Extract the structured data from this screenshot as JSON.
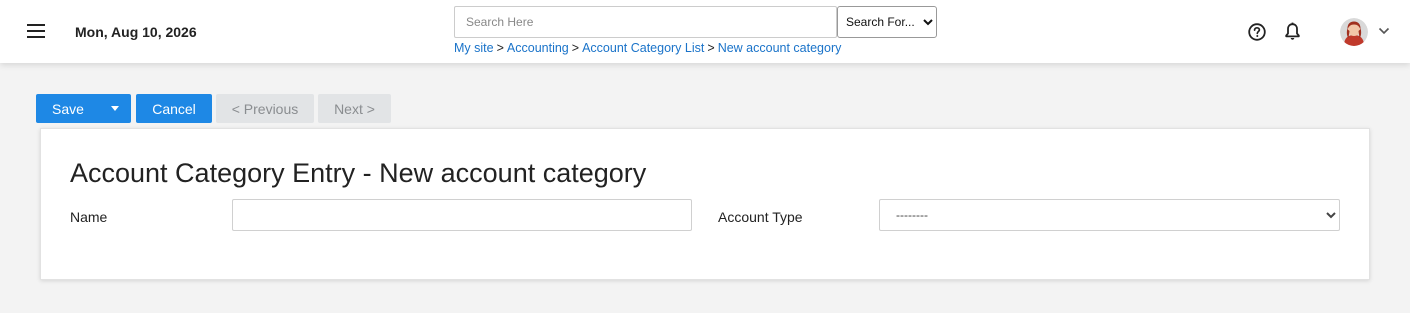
{
  "header": {
    "date": "Mon, Aug 10, 2026",
    "search": {
      "placeholder": "Search Here",
      "value": ""
    },
    "search_scope": {
      "selected": "Search For..."
    },
    "breadcrumb": [
      "My site",
      "Accounting",
      "Account Category List",
      "New account category"
    ],
    "breadcrumb_separator": ">",
    "icons": {
      "menu": "hamburger-menu-icon",
      "help": "help-circle-icon",
      "notifications": "bell-icon",
      "account": "chevron-down-icon"
    }
  },
  "toolbar": {
    "save_label": "Save",
    "cancel_label": "Cancel",
    "previous_label": "< Previous",
    "next_label": "Next >"
  },
  "form": {
    "title": "Account Category Entry - New account category",
    "fields": {
      "name_label": "Name",
      "name_value": "",
      "account_type_label": "Account Type",
      "account_type_selected": "--------"
    }
  },
  "colors": {
    "primary": "#1e88e5",
    "link": "#1a73c9",
    "disabled_bg": "#e2e4e6",
    "page_bg": "#f3f3f3"
  }
}
